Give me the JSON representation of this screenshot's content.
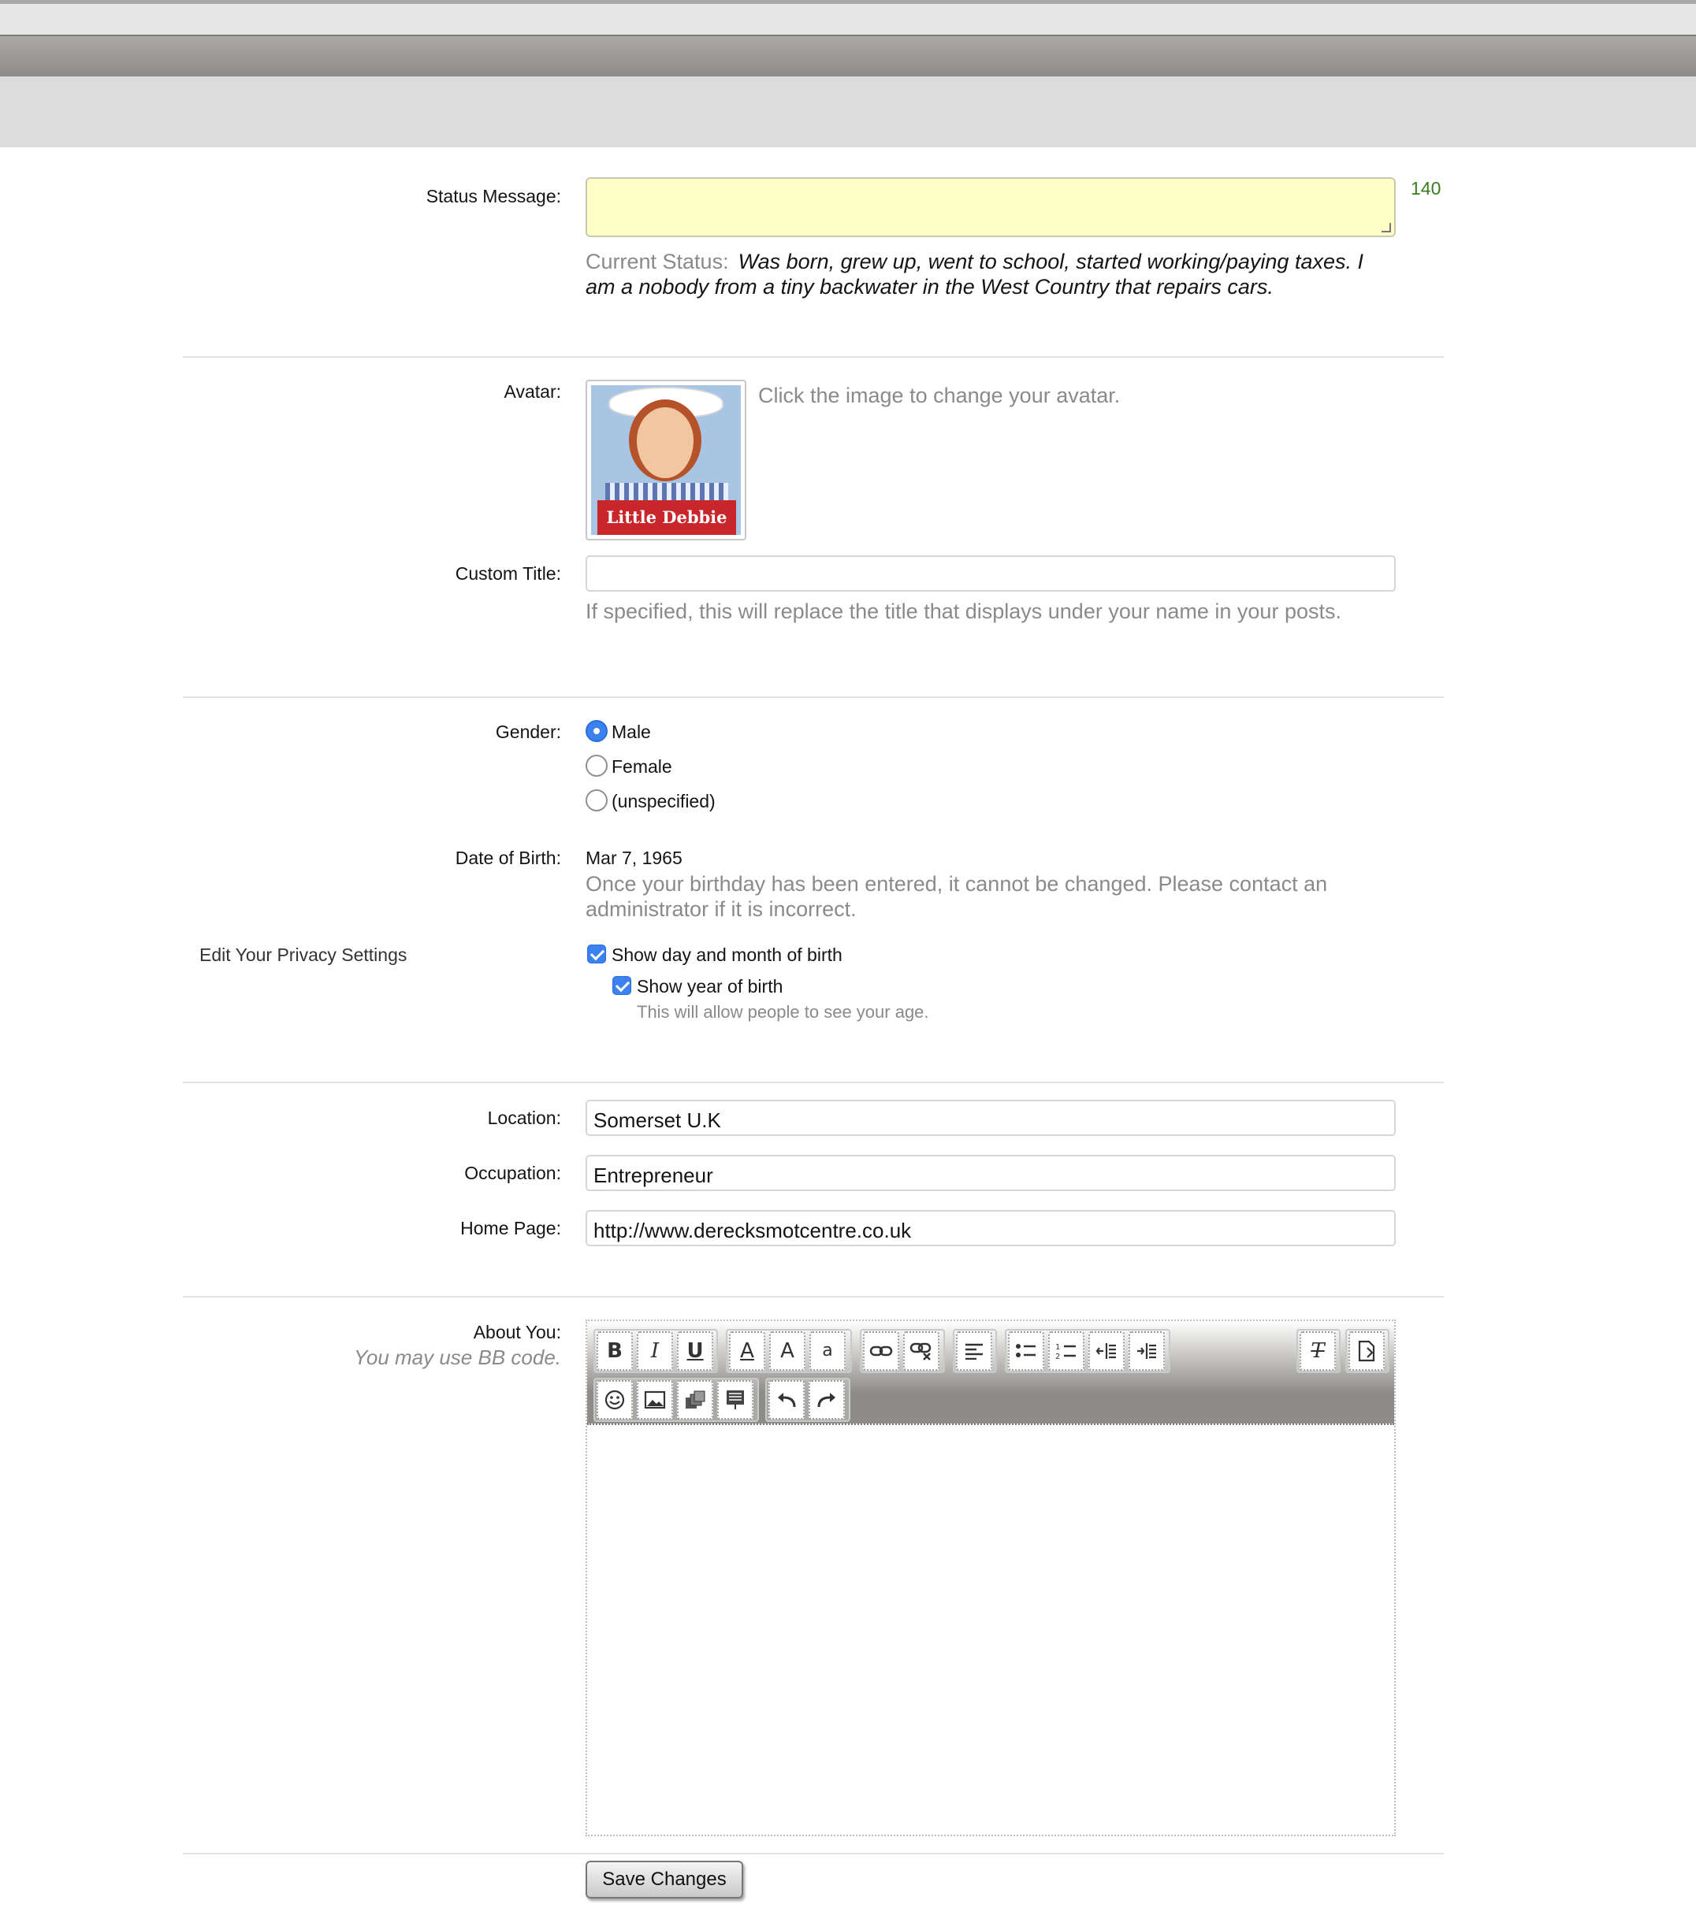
{
  "status": {
    "label": "Status Message:",
    "value": "",
    "counter": "140",
    "current_label": "Current Status:",
    "current_text": "Was born, grew up, went to school, started working/paying taxes. I am a nobody from a tiny backwater in the West Country that repairs cars."
  },
  "avatar": {
    "label": "Avatar:",
    "hint": "Click the image to change your avatar.",
    "image_text": "Little Debbie"
  },
  "custom_title": {
    "label": "Custom Title:",
    "value": "",
    "hint": "If specified, this will replace the title that displays under your name in your posts."
  },
  "gender": {
    "label": "Gender:",
    "options": [
      "Male",
      "Female",
      "(unspecified)"
    ],
    "selected": "Male"
  },
  "dob": {
    "label": "Date of Birth:",
    "value": "Mar 7, 1965",
    "hint": "Once your birthday has been entered, it cannot be changed. Please contact an administrator if it is incorrect."
  },
  "privacy": {
    "label": "Edit Your Privacy Settings",
    "show_day_month": "Show day and month of birth",
    "show_year": "Show year of birth",
    "year_hint": "This will allow people to see your age."
  },
  "location": {
    "label": "Location:",
    "value": "Somerset U.K"
  },
  "occupation": {
    "label": "Occupation:",
    "value": "Entrepreneur"
  },
  "homepage": {
    "label": "Home Page:",
    "value": "http://www.derecksmotcentre.co.uk"
  },
  "about": {
    "label": "About You:",
    "hint": "You may use BB code.",
    "toolbar": {
      "bold": "B",
      "italic": "I",
      "underline": "U",
      "font_color": "A",
      "font_size": "A",
      "font_family": "a",
      "remove_format": "T"
    }
  },
  "save_label": "Save Changes",
  "colors": {
    "status_bg": "#ffffc8",
    "counter": "#3a7d1e",
    "accent": "#3b82f0",
    "hint": "#8a8a8a"
  }
}
